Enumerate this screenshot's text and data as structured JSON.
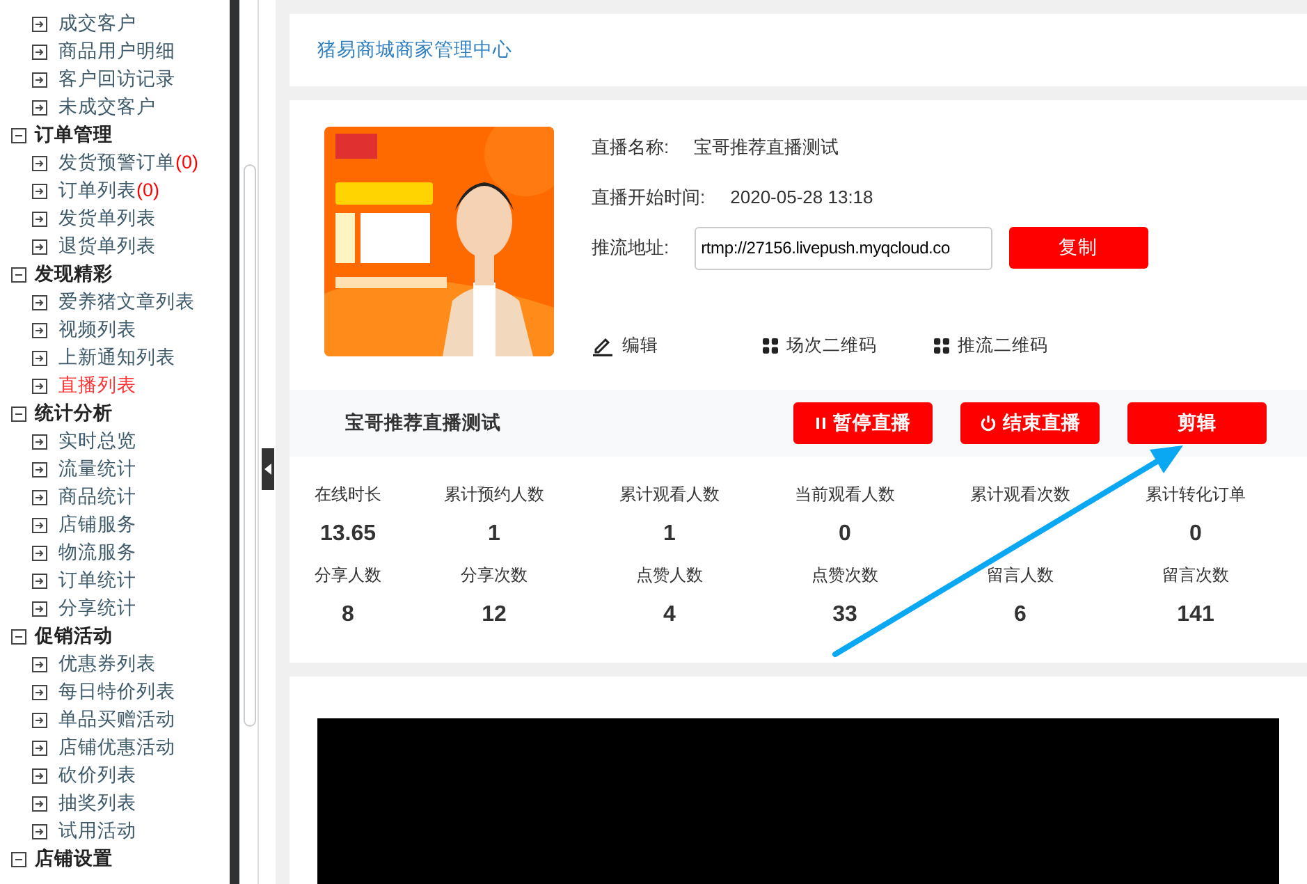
{
  "sidebar": {
    "groups": [
      {
        "children": [
          {
            "label": "成交客户",
            "selected": false
          },
          {
            "label": "商品用户明细",
            "selected": false
          },
          {
            "label": "客户回访记录",
            "selected": false
          },
          {
            "label": "未成交客户",
            "selected": false
          }
        ]
      },
      {
        "label": "订单管理",
        "expanded": true,
        "children": [
          {
            "label": "发货预警订单",
            "count": "(0)",
            "selected": false
          },
          {
            "label": "订单列表",
            "count": "(0)",
            "selected": false
          },
          {
            "label": "发货单列表",
            "selected": false
          },
          {
            "label": "退货单列表",
            "selected": false
          }
        ]
      },
      {
        "label": "发现精彩",
        "expanded": true,
        "children": [
          {
            "label": "爱养猪文章列表",
            "selected": false
          },
          {
            "label": "视频列表",
            "selected": false
          },
          {
            "label": "上新通知列表",
            "selected": false
          },
          {
            "label": "直播列表",
            "selected": true
          }
        ]
      },
      {
        "label": "统计分析",
        "expanded": true,
        "children": [
          {
            "label": "实时总览",
            "selected": false
          },
          {
            "label": "流量统计",
            "selected": false
          },
          {
            "label": "商品统计",
            "selected": false
          },
          {
            "label": "店铺服务",
            "selected": false
          },
          {
            "label": "物流服务",
            "selected": false
          },
          {
            "label": "订单统计",
            "selected": false
          },
          {
            "label": "分享统计",
            "selected": false
          }
        ]
      },
      {
        "label": "促销活动",
        "expanded": true,
        "children": [
          {
            "label": "优惠券列表",
            "selected": false
          },
          {
            "label": "每日特价列表",
            "selected": false
          },
          {
            "label": "单品买赠活动",
            "selected": false
          },
          {
            "label": "店铺优惠活动",
            "selected": false
          },
          {
            "label": "砍价列表",
            "selected": false
          },
          {
            "label": "抽奖列表",
            "selected": false
          },
          {
            "label": "试用活动",
            "selected": false
          }
        ]
      },
      {
        "label": "店铺设置",
        "expanded": true
      }
    ]
  },
  "header": {
    "title": "猪易商城商家管理中心"
  },
  "live": {
    "fields": [
      {
        "kind": "text",
        "label": "直播名称:",
        "value": "宝哥推荐直播测试"
      },
      {
        "kind": "text",
        "label": "直播开始时间:",
        "value": "2020-05-28 13:18"
      },
      {
        "kind": "input",
        "label": "推流地址:",
        "value": "rtmp://27156.livepush.myqcloud.co",
        "button": "复制"
      }
    ],
    "actions": [
      {
        "kind": "edit",
        "label": "编辑"
      },
      {
        "kind": "qr",
        "label": "场次二维码"
      },
      {
        "kind": "qr",
        "label": "推流二维码"
      }
    ],
    "name": "宝哥推荐直播测试",
    "buttons": [
      {
        "kind": "pause",
        "label": "暂停直播"
      },
      {
        "kind": "power",
        "label": "结束直播"
      },
      {
        "kind": "plain",
        "label": "剪辑"
      }
    ],
    "stats": [
      {
        "label": "在线时长",
        "value": "13.65"
      },
      {
        "label": "累计预约人数",
        "value": "1"
      },
      {
        "label": "累计观看人数",
        "value": "1"
      },
      {
        "label": "当前观看人数",
        "value": "0"
      },
      {
        "label": "累计观看次数"
      },
      {
        "label": "累计转化订单",
        "value": "0"
      },
      {
        "label": "分享人数",
        "value": "8"
      },
      {
        "label": "分享次数",
        "value": "12"
      },
      {
        "label": "点赞人数",
        "value": "4"
      },
      {
        "label": "点赞次数",
        "value": "33"
      },
      {
        "label": "留言人数",
        "value": "6"
      },
      {
        "label": "留言次数",
        "value": "141"
      }
    ]
  }
}
